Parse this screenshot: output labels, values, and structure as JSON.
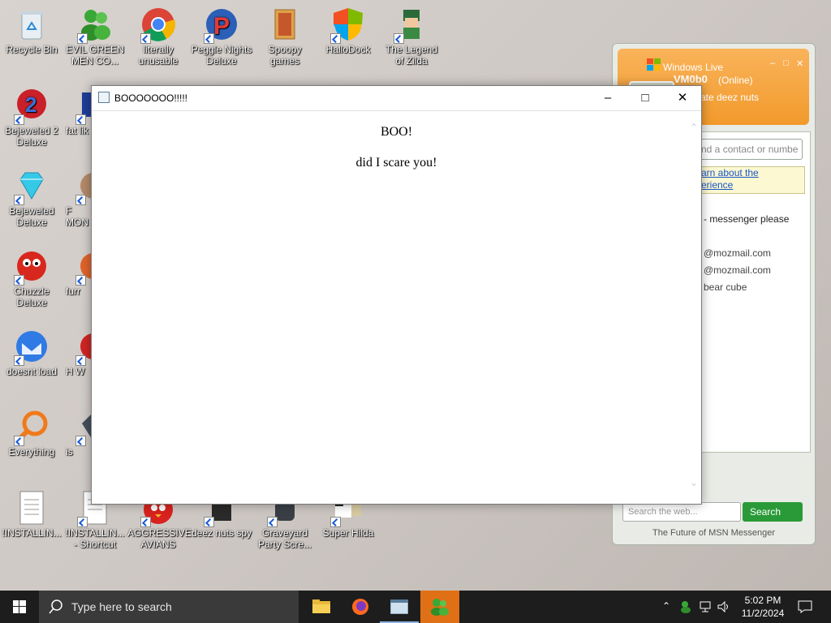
{
  "desktop": {
    "icons": [
      {
        "label": "Recycle Bin"
      },
      {
        "label": "EVIL GREEN MEN CO..."
      },
      {
        "label": "literally unusable"
      },
      {
        "label": "Peggle Nights Deluxe"
      },
      {
        "label": "Spoopy games"
      },
      {
        "label": "HalloDock"
      },
      {
        "label": "The Legend of Zilda"
      },
      {
        "label": "Bejeweled 2 Deluxe"
      },
      {
        "label": "fat lik"
      },
      {
        "label": "Bejeweled Deluxe"
      },
      {
        "label": "F MON"
      },
      {
        "label": "Chuzzle Deluxe"
      },
      {
        "label": "furr"
      },
      {
        "label": "doesnt load"
      },
      {
        "label": "H W"
      },
      {
        "label": "Everything"
      },
      {
        "label": "is"
      },
      {
        "label": "!INSTALLIN..."
      },
      {
        "label": "!INSTALLIN... - Shortcut"
      },
      {
        "label": "AGGRESSIVE AVIANS"
      },
      {
        "label": "deez nuts spy"
      },
      {
        "label": "Graveyard Party Scre..."
      },
      {
        "label": "Super Hilda"
      }
    ]
  },
  "popup": {
    "title": "BOOOOOOO!!!!!",
    "line1": "BOO!",
    "line2": "did I scare you!"
  },
  "messenger": {
    "title": "Windows Live",
    "name": "VM0b0",
    "status": "(Online)",
    "personal_message": "rate deez nuts",
    "find_placeholder": "nd a contact or numbe",
    "ad_line1": "arn about the",
    "ad_line2": "erience",
    "text1": "- messenger please",
    "text2": "@mozmail.com",
    "text3": "@mozmail.com",
    "text4": "bear cube",
    "search_placeholder": "Search the web...",
    "search_button": "Search",
    "footer": "The Future of MSN Messenger"
  },
  "taskbar": {
    "search_placeholder": "Type here to search",
    "time": "5:02 PM",
    "date": "11/2/2024"
  }
}
